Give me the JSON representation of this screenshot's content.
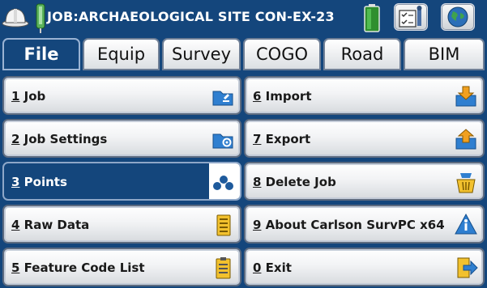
{
  "title": {
    "job_label": "JOB:ARCHAEOLOGICAL SITE CON-EX-23",
    "icons": [
      "hard-hat-icon",
      "gps-receiver-icon",
      "battery-icon",
      "configure-icon",
      "globe-icon"
    ]
  },
  "tabs": [
    {
      "label": "File",
      "active": true
    },
    {
      "label": "Equip",
      "active": false
    },
    {
      "label": "Survey",
      "active": false
    },
    {
      "label": "COGO",
      "active": false
    },
    {
      "label": "Road",
      "active": false
    },
    {
      "label": "BIM",
      "active": false
    }
  ],
  "menu": {
    "left": [
      {
        "num": "1",
        "text": "Job",
        "icon": "job-folder-icon"
      },
      {
        "num": "2",
        "text": "Job Settings",
        "icon": "job-settings-icon"
      },
      {
        "num": "3",
        "text": "Points",
        "icon": "points-icon",
        "selected": true
      },
      {
        "num": "4",
        "text": "Raw Data",
        "icon": "raw-data-icon"
      },
      {
        "num": "5",
        "text": "Feature Code List",
        "icon": "feature-code-list-icon"
      }
    ],
    "right": [
      {
        "num": "6",
        "text": "Import",
        "icon": "import-icon"
      },
      {
        "num": "7",
        "text": "Export",
        "icon": "export-icon"
      },
      {
        "num": "8",
        "text": "Delete Job",
        "icon": "delete-job-icon"
      },
      {
        "num": "9",
        "text": "About Carlson SurvPC x64",
        "icon": "about-icon"
      },
      {
        "num": "0",
        "text": "Exit",
        "icon": "exit-icon"
      }
    ]
  },
  "colors": {
    "primary": "#14467c",
    "selected": "#14467c",
    "battery": "#2f8f2f"
  }
}
